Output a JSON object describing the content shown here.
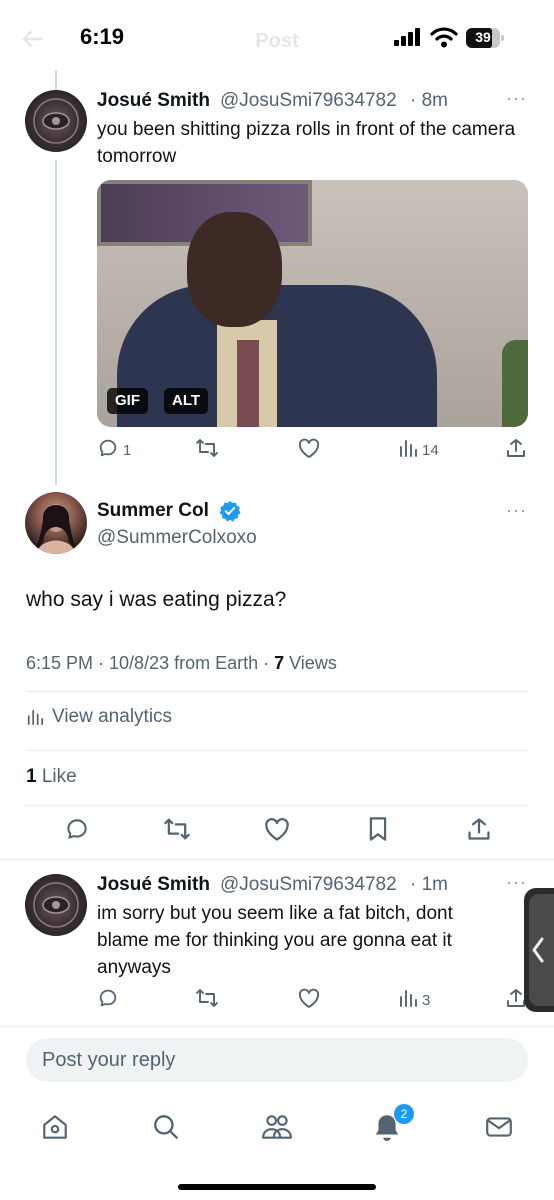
{
  "status_bar": {
    "time": "6:19",
    "battery": "39"
  },
  "header": {
    "title": "Post"
  },
  "reply_context": {
    "name": "Josué Smith",
    "handle": "@JosuSmi79634782",
    "time": "· 8m",
    "text": "you been shitting pizza rolls in front of the camera tomorrow",
    "media_badges": [
      "GIF",
      "ALT"
    ],
    "actions": {
      "replies": "1",
      "views": "14"
    }
  },
  "main_post": {
    "name": "Summer Col",
    "handle": "@SummerColxoxo",
    "text": "who say i was eating pizza?",
    "meta_prefix": "6:15 PM · 10/8/23 from Earth · ",
    "views_count": "7",
    "views_label": " Views",
    "analytics_label": "View analytics",
    "likes_count": "1",
    "likes_label": " Like",
    "verified_color": "#1d9bf0"
  },
  "reply": {
    "name": "Josué Smith",
    "handle": "@JosuSmi79634782",
    "time": "· 1m",
    "text": "im sorry but you seem like a fat bitch, dont blame me for thinking you are gonna eat it anyways",
    "actions": {
      "views": "3"
    }
  },
  "composer": {
    "placeholder": "Post your reply"
  },
  "bottom_nav": {
    "items": [
      "home-icon",
      "search-icon",
      "communities-icon",
      "notifications-icon",
      "messages-icon"
    ],
    "notification_badge": "2"
  },
  "colors": {
    "accent": "#1d9bf0",
    "text": "#0f1419",
    "secondary": "#536471"
  }
}
